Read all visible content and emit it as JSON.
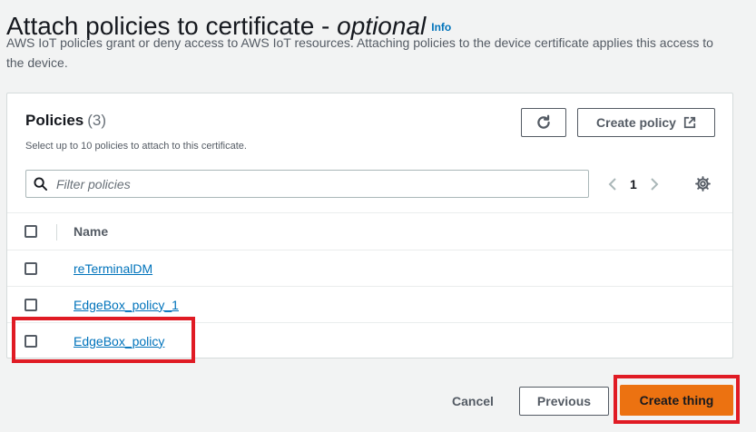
{
  "header": {
    "title_main": "Attach policies to certificate - ",
    "title_italic": "optional",
    "info_link": "Info",
    "description": "AWS IoT policies grant or deny access to AWS IoT resources. Attaching policies to the device certificate applies this access to the device."
  },
  "policies_panel": {
    "title": "Policies",
    "count": "(3)",
    "subtitle": "Select up to 10 policies to attach to this certificate.",
    "create_policy_label": "Create policy",
    "search_placeholder": "Filter policies",
    "current_page": "1",
    "column_header": "Name",
    "rows": [
      {
        "name": "reTerminalDM",
        "selected": false
      },
      {
        "name": "EdgeBox_policy_1",
        "selected": false
      },
      {
        "name": "EdgeBox_policy",
        "selected": false
      }
    ]
  },
  "footer": {
    "cancel_label": "Cancel",
    "previous_label": "Previous",
    "create_thing_label": "Create thing"
  },
  "colors": {
    "link": "#0073bb",
    "primary_button": "#ec7211",
    "highlight": "#e01b24"
  },
  "icons": {
    "refresh": "refresh-icon",
    "external": "external-link-icon",
    "search": "search-icon",
    "prev": "chevron-left-icon",
    "next": "chevron-right-icon",
    "settings": "gear-icon"
  }
}
